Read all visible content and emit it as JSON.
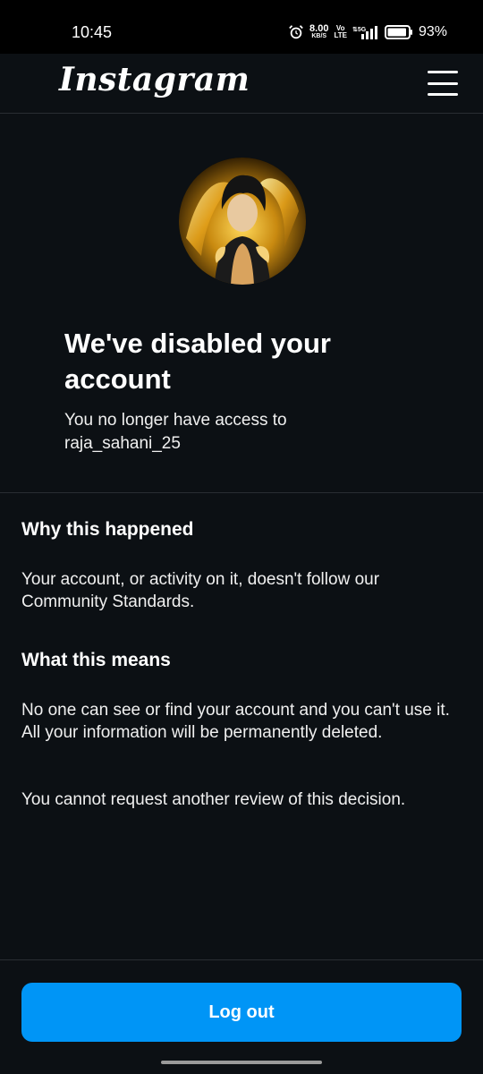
{
  "status_bar": {
    "time": "10:45",
    "network_speed": "8.00",
    "network_speed_unit": "KB/S",
    "volte_top": "Vo",
    "volte_bottom": "LTE",
    "network_type": "5G",
    "battery_percent": "93%",
    "battery_level": 0.93
  },
  "header": {
    "logo": "Instagram",
    "menu_icon": "hamburger-menu-icon"
  },
  "account": {
    "avatar_icon": "profile-avatar",
    "title": "We've disabled your account",
    "subtitle_line1": "You no longer have access to",
    "username": "raja_sahani_25"
  },
  "sections": {
    "why_heading": "Why this happened",
    "why_text": "Your account, or activity on it, doesn't follow our Community Standards.",
    "means_heading": "What this means",
    "means_text": "No one can see or find your account and you can't use it. All your information will be permanently deleted.",
    "review_text": "You cannot request another review of this decision."
  },
  "actions": {
    "logout_label": "Log out"
  },
  "colors": {
    "background": "#0c1014",
    "accent": "#0095f6",
    "divider": "#2a2e33"
  }
}
